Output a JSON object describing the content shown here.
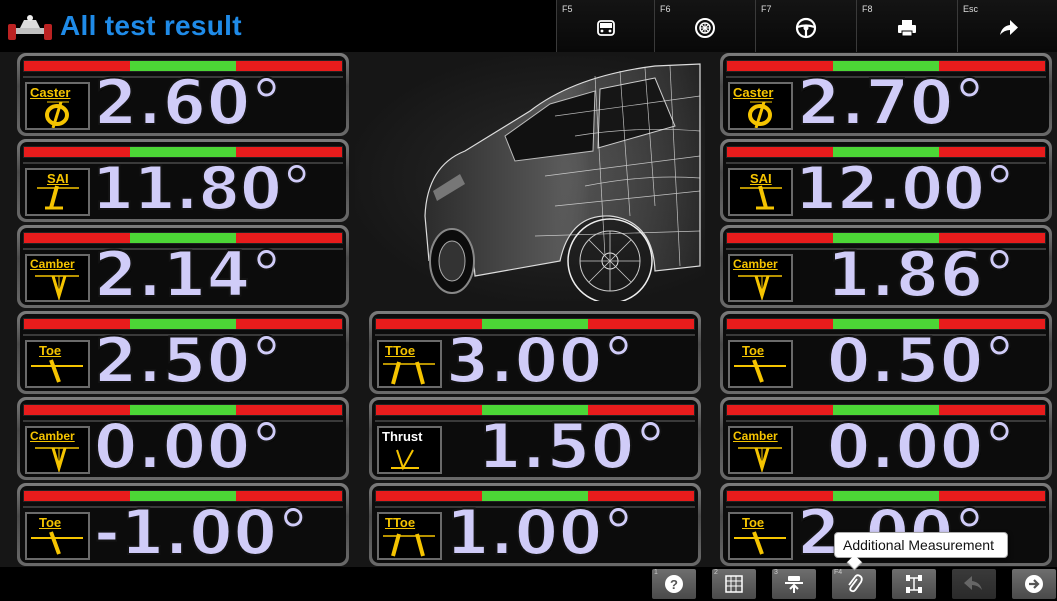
{
  "header": {
    "title": "All test result",
    "fkeys": [
      {
        "key": "F5",
        "icon": "car-front-icon"
      },
      {
        "key": "F6",
        "icon": "wheel-icon"
      },
      {
        "key": "F7",
        "icon": "steering-wheel-icon"
      },
      {
        "key": "F8",
        "icon": "printer-icon"
      },
      {
        "key": "Esc",
        "icon": "forward-arrow-icon"
      }
    ]
  },
  "colors": {
    "title": "#1f8be8",
    "value": "#d0ccf8",
    "range_red": "#e81c1c",
    "range_green": "#4cd636",
    "icon_yellow": "#f5c400"
  },
  "tiles": {
    "left": [
      {
        "label": "Caster",
        "value": "2.60°",
        "icon": "caster-icon"
      },
      {
        "label": "SAI",
        "value": "11.80°",
        "icon": "sai-icon"
      },
      {
        "label": "Camber",
        "value": "2.14°",
        "icon": "camber-icon"
      },
      {
        "label": "Toe",
        "value": "2.50°",
        "icon": "toe-icon"
      },
      {
        "label": "Camber",
        "value": "0.00°",
        "icon": "camber-icon"
      },
      {
        "label": "Toe",
        "value": "-1.00°",
        "icon": "toe-icon"
      }
    ],
    "center": [
      {
        "label": "TToe",
        "value": "3.00°",
        "icon": "total-toe-icon"
      },
      {
        "label": "Thrust",
        "value": "1.50°",
        "icon": "thrust-icon"
      },
      {
        "label": "TToe",
        "value": "1.00°",
        "icon": "total-toe-icon"
      }
    ],
    "right": [
      {
        "label": "Caster",
        "value": "2.70°",
        "icon": "caster-icon"
      },
      {
        "label": "SAI",
        "value": "12.00°",
        "icon": "sai-icon"
      },
      {
        "label": "Camber",
        "value": "1.86°",
        "icon": "camber-icon"
      },
      {
        "label": "Toe",
        "value": "0.50°",
        "icon": "toe-icon"
      },
      {
        "label": "Camber",
        "value": "0.00°",
        "icon": "camber-icon"
      },
      {
        "label": "Toe",
        "value": "2.00°",
        "icon": "toe-icon"
      }
    ]
  },
  "footer": {
    "buttons": [
      {
        "num": "1",
        "icon": "help-icon"
      },
      {
        "num": "2",
        "icon": "calculator-icon"
      },
      {
        "num": "3",
        "icon": "lift-icon"
      },
      {
        "num": "F4",
        "icon": "paperclip-icon"
      },
      {
        "num": "",
        "icon": "axle-icon"
      },
      {
        "num": "",
        "icon": "back-icon"
      },
      {
        "num": "",
        "icon": "next-icon"
      }
    ],
    "tooltip": "Additional Measurement"
  }
}
